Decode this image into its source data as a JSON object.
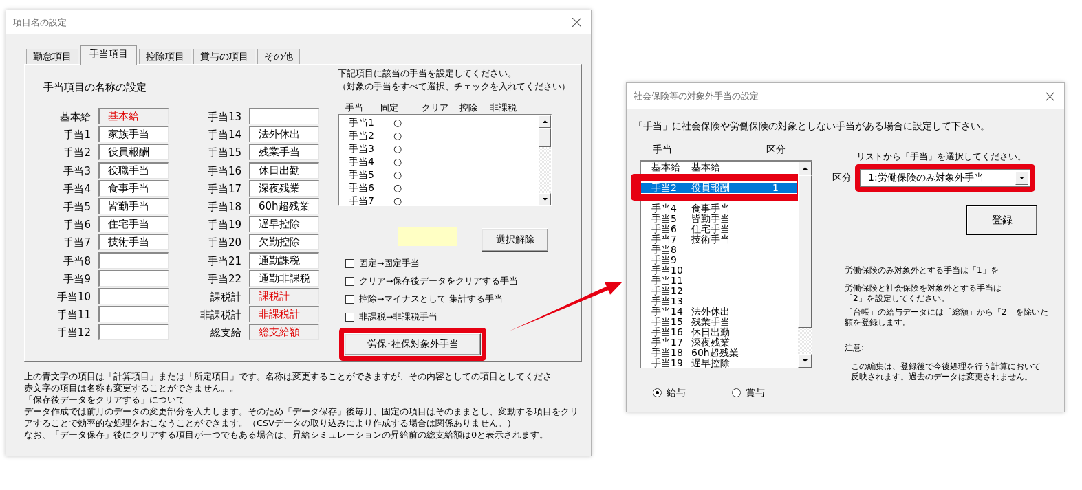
{
  "left_dialog": {
    "title": "項目名の設定",
    "tabs": [
      {
        "label": "勤怠項目",
        "selected": false
      },
      {
        "label": "手当項目",
        "selected": true
      },
      {
        "label": "控除項目",
        "selected": false
      },
      {
        "label": "賞与の項目",
        "selected": false
      },
      {
        "label": "その他",
        "selected": false
      }
    ],
    "heading": "手当項目の名称の設定",
    "name_columns": [
      [
        {
          "label": "基本給",
          "value": "基本給",
          "readonly": true
        },
        {
          "label": "手当1",
          "value": "家族手当",
          "readonly": false
        },
        {
          "label": "手当2",
          "value": "役員報酬",
          "readonly": false
        },
        {
          "label": "手当3",
          "value": "役職手当",
          "readonly": false
        },
        {
          "label": "手当4",
          "value": "食事手当",
          "readonly": false
        },
        {
          "label": "手当5",
          "value": "皆勤手当",
          "readonly": false
        },
        {
          "label": "手当6",
          "value": "住宅手当",
          "readonly": false
        },
        {
          "label": "手当7",
          "value": "技術手当",
          "readonly": false
        },
        {
          "label": "手当8",
          "readonly": false
        },
        {
          "label": "手当9",
          "readonly": false
        },
        {
          "label": "手当10",
          "readonly": false
        },
        {
          "label": "手当11",
          "readonly": false
        },
        {
          "label": "手当12",
          "readonly": false
        }
      ],
      [
        {
          "label": "手当13",
          "readonly": false
        },
        {
          "label": "手当14",
          "value": "法外休出",
          "readonly": false
        },
        {
          "label": "手当15",
          "value": "残業手当",
          "readonly": false
        },
        {
          "label": "手当16",
          "value": "休日出勤",
          "readonly": false
        },
        {
          "label": "手当17",
          "value": "深夜残業",
          "readonly": false
        },
        {
          "label": "手当18",
          "value": "60h超残業",
          "readonly": false
        },
        {
          "label": "手当19",
          "value": "遅早控除",
          "readonly": false
        },
        {
          "label": "手当20",
          "value": "欠勤控除",
          "readonly": false
        },
        {
          "label": "手当21",
          "value": "通勤課税",
          "readonly": false
        },
        {
          "label": "手当22",
          "value": "通勤非課税",
          "readonly": false
        },
        {
          "label": "課税計",
          "value": "課税計",
          "readonly": true
        },
        {
          "label": "非課税計",
          "value": "非課税計",
          "readonly": true
        },
        {
          "label": "総支給",
          "value": "総支給額",
          "readonly": true
        }
      ]
    ],
    "instructions": [
      "下記項目に該当の手当を設定してください。",
      "（対象の手当をすべて選択、チェックを入れてください）"
    ],
    "assign_list": {
      "columns": [
        "手当",
        "固定",
        "クリア",
        "控除",
        "非課税"
      ],
      "rows": [
        {
          "name": "手当1",
          "fixed": "○"
        },
        {
          "name": "手当2",
          "fixed": "○"
        },
        {
          "name": "手当3",
          "fixed": "○"
        },
        {
          "name": "手当4",
          "fixed": "○"
        },
        {
          "name": "手当5",
          "fixed": "○"
        },
        {
          "name": "手当6",
          "fixed": "○"
        },
        {
          "name": "手当7",
          "fixed": "○"
        }
      ]
    },
    "clear_selection_button": "選択解除",
    "legend": [
      {
        "label": "固定→固定手当",
        "checked": false
      },
      {
        "label": "クリア→保存後データをクリアする手当",
        "checked": false
      },
      {
        "label": "控除→マイナスとして 集計する手当",
        "checked": false
      },
      {
        "label": "非課税→非課税手当",
        "checked": false
      }
    ],
    "exempt_button": {
      "label": "労保･社保対象外手当",
      "highlighted": true
    },
    "notes": [
      "上の青文字の項目は「計算項目」または「所定項目」です。名称は変更することができますが、その内容としての項目としてくださ",
      "赤文字の項目は名称も変更することができません。。",
      "「保存後データをクリアする」について",
      "データ作成では前月のデータの変更部分を入力します。そのため「データ保存」後毎月、固定の項目はそのままとし、変動する項目をクリアすることで効率的な処理をおこなうことができます。（CSVデータの取り込みにより作成する場合は関係ありません。）",
      "なお、「データ保存」後にクリアする項目が一つでもある場合は、昇給シミュレーションの昇給前の総支給額は0と表示されます。"
    ]
  },
  "right_dialog": {
    "title": "社会保険等の対象外手当の設定",
    "intro": "「手当」に社会保険や労働保険の対象としない手当がある場合に設定して下さい。",
    "list_columns": [
      "手当",
      "区分"
    ],
    "list_rows": [
      {
        "name": "基本給",
        "value": "基本給",
        "selected": false
      },
      {
        "name": "手当2",
        "value": "役員報酬",
        "category": "1",
        "selected": true,
        "highlighted": true
      },
      {
        "name": "手当4",
        "value": "食事手当",
        "selected": false
      },
      {
        "name": "手当5",
        "value": "皆勤手当",
        "selected": false
      },
      {
        "name": "手当6",
        "value": "住宅手当",
        "selected": false
      },
      {
        "name": "手当7",
        "value": "技術手当",
        "selected": false
      },
      {
        "name": "手当8",
        "selected": false
      },
      {
        "name": "手当9",
        "selected": false
      },
      {
        "name": "手当10",
        "selected": false
      },
      {
        "name": "手当11",
        "selected": false
      },
      {
        "name": "手当12",
        "selected": false
      },
      {
        "name": "手当13",
        "selected": false
      },
      {
        "name": "手当14",
        "value": "法外休出",
        "selected": false
      },
      {
        "name": "手当15",
        "value": "残業手当",
        "selected": false
      },
      {
        "name": "手当16",
        "value": "休日出勤",
        "selected": false
      },
      {
        "name": "手当17",
        "value": "深夜残業",
        "selected": false
      },
      {
        "name": "手当18",
        "value": "60h超残業",
        "selected": false
      },
      {
        "name": "手当19",
        "value": "遅早控除",
        "selected": false
      }
    ],
    "pay_types": [
      {
        "label": "給与",
        "selected": true
      },
      {
        "label": "賞与",
        "selected": false
      }
    ],
    "select_hint": "リストから「手当」を選択してください。",
    "category": {
      "label": "区分",
      "value": "1:労働保険のみ対象外手当",
      "highlighted": true
    },
    "register_button": "登録",
    "notes": [
      "労働保険のみ対象外とする手当は「1」を",
      "労働保険と社会保険を対象外とする手当は「2」を設定してください。",
      "「台帳」の給与データには「総額」から「2」を除いた額を登録します。",
      "注意:",
      "この編集は、登録後で今後処理を行う計算において反映されます。過去のデータは変更されません。"
    ]
  }
}
